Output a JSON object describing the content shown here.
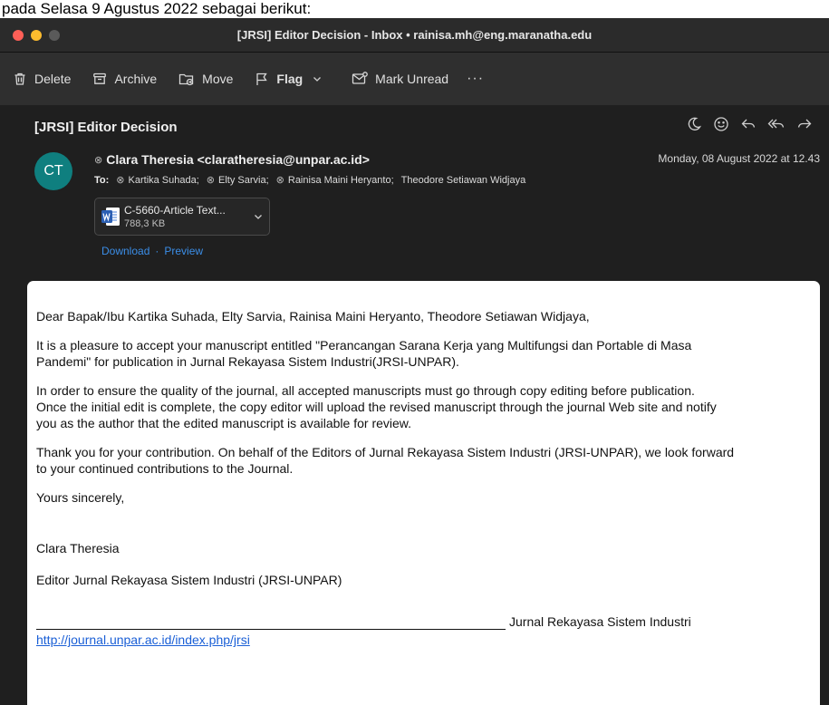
{
  "caption": "pada Selasa 9 Agustus 2022 sebagai berikut:",
  "window": {
    "title": "[JRSI] Editor Decision - Inbox • rainisa.mh@eng.maranatha.edu"
  },
  "toolbar": {
    "delete": "Delete",
    "archive": "Archive",
    "move": "Move",
    "flag": "Flag",
    "mark_unread": "Mark Unread",
    "more": "···"
  },
  "message": {
    "subject": "[JRSI] Editor Decision",
    "avatar_initials": "CT",
    "from": "Clara Theresia <claratheresia@unpar.ac.id>",
    "date": "Monday, 08 August 2022 at 12.43",
    "to_label": "To:",
    "recipients": [
      "Kartika Suhada;",
      "Elty Sarvia;",
      "Rainisa Maini Heryanto;",
      "Theodore Setiawan Widjaya"
    ],
    "attachment": {
      "name": "C-5660-Article Text...",
      "size": "788,3 KB",
      "download": "Download",
      "separator": "·",
      "preview": "Preview"
    },
    "body": {
      "greeting": "Dear Bapak/Ibu Kartika Suhada, Elty Sarvia, Rainisa Maini Heryanto, Theodore Setiawan Widjaya,",
      "p1_line1": "It is a pleasure to accept your manuscript entitled \"Perancangan Sarana Kerja yang Multifungsi dan Portable di Masa",
      "p1_line2": "Pandemi\" for publication in Jurnal Rekayasa Sistem Industri(JRSI-UNPAR).",
      "p2_line1": "In order to ensure the quality of the journal, all accepted manuscripts must go through copy editing before publication.",
      "p2_line2": "Once the initial edit is complete, the copy editor will upload the revised manuscript through the journal Web site and notify",
      "p2_line3": "you as the author that the edited manuscript is available for review.",
      "p3_line1": "Thank you for your contribution. On behalf of the Editors of Jurnal Rekayasa Sistem Industri (JRSI-UNPAR), we look forward",
      "p3_line2": "to your continued contributions to the Journal.",
      "closing": "Yours sincerely,",
      "signature_name": "Clara Theresia",
      "signature_title": "Editor Jurnal Rekayasa Sistem Industri (JRSI-UNPAR)",
      "footer_journal": "Jurnal Rekayasa Sistem Industri",
      "footer_link": "http://journal.unpar.ac.id/index.php/jrsi"
    }
  },
  "colors": {
    "titlebar": "#2b2b2b",
    "toolbar": "#2f2f2f",
    "pane": "#1f1f1f",
    "avatar": "#0f7f7f",
    "link_blue": "#3b8ee8",
    "body_link": "#1a5fd6",
    "word_blue": "#2b5fb3"
  }
}
